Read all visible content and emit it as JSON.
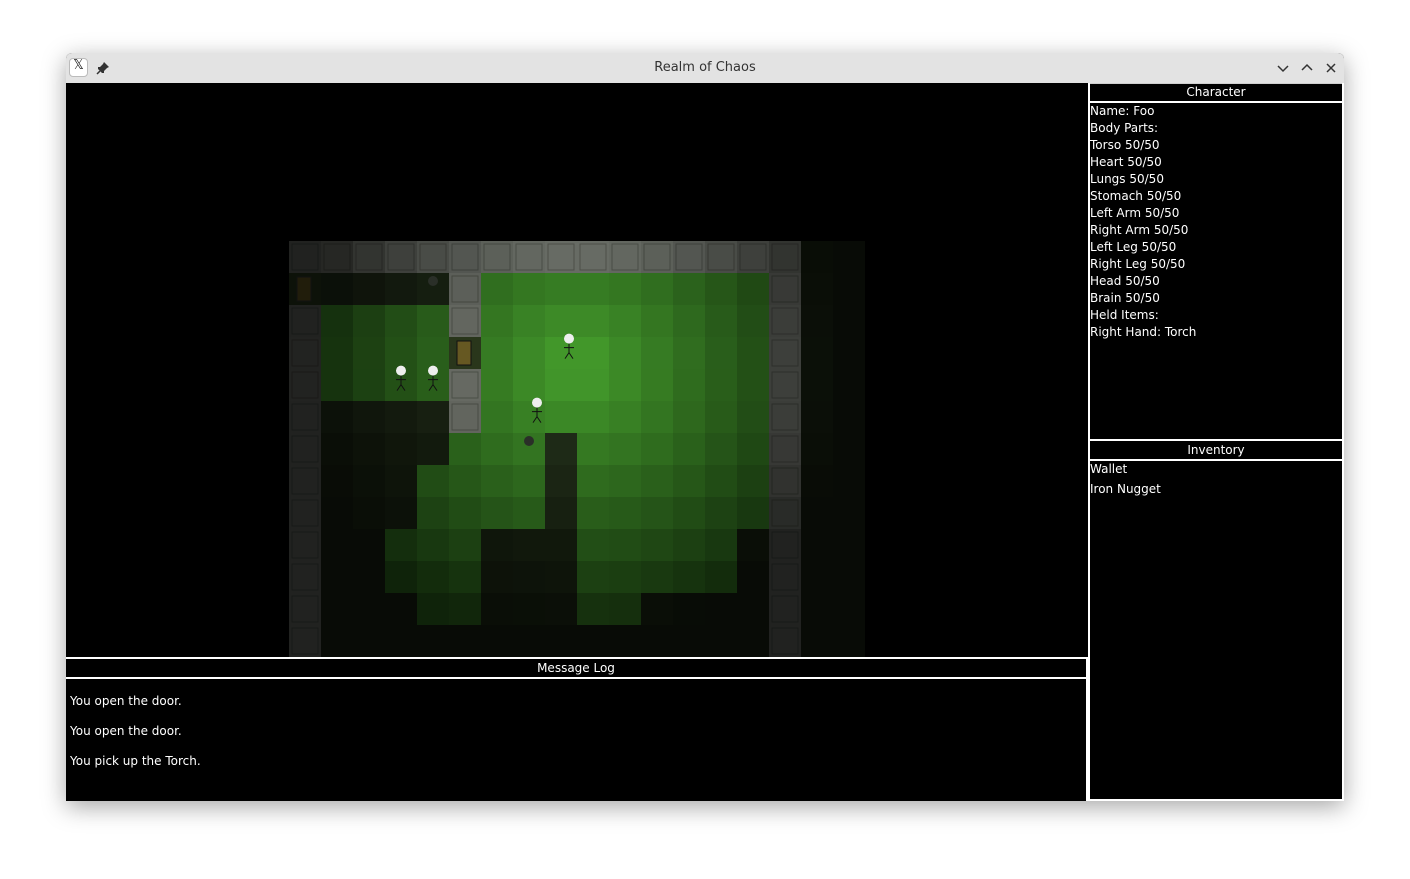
{
  "window": {
    "title": "Realm of Chaos",
    "controls": {
      "minimize": "⌄",
      "maximize": "⌃",
      "close": "✕"
    }
  },
  "log": {
    "header": "Message Log",
    "lines": [
      "You open the door.",
      "You open the door.",
      "You pick up the Torch."
    ]
  },
  "character": {
    "header": "Character",
    "lines": [
      "Name: Foo",
      "Body Parts:",
      "Torso 50/50",
      "Heart 50/50",
      "Lungs 50/50",
      "Stomach 50/50",
      "Left Arm 50/50",
      "Right Arm 50/50",
      "Left Leg 50/50",
      "Right Leg 50/50",
      "Head 50/50",
      "Brain 50/50",
      "Held Items:",
      "Right Hand: Torch"
    ]
  },
  "inventory": {
    "header": "Inventory",
    "items": [
      "Wallet",
      "Iron Nugget"
    ]
  },
  "colors": {
    "grass": "#3f8f2a",
    "wall": "#8a8f86",
    "background": "#000000",
    "panel_border": "#ffffff"
  }
}
